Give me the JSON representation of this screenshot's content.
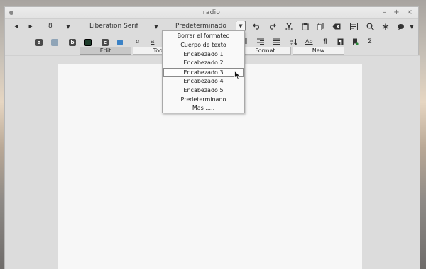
{
  "window": {
    "title": "radio",
    "controls": [
      "–",
      "+",
      "×"
    ]
  },
  "toolbar1": {
    "prev_icon": "◂",
    "next_icon": "▸",
    "font_size": "8",
    "font_name": "Liberation Serif",
    "paragraph_style": "Predeterminado",
    "arrow": "▼"
  },
  "toolbar2": {
    "swatch_a": "a",
    "swatch_b": "b",
    "swatch_c": "c",
    "italic_a": "a",
    "underline_a": "a",
    "pilcrow": "¶",
    "sigma": "Σ",
    "spell": "Ab"
  },
  "tabs": [
    "Edit",
    "Tool",
    "Format",
    "New"
  ],
  "style_menu": {
    "items": [
      "Borrar el formateo",
      "Cuerpo de texto",
      "Encabezado 1",
      "Encabezado 2",
      "Encabezado 3",
      "Encabezado 4",
      "Encabezado 5",
      "Predeterminado",
      "Mas ....."
    ],
    "selected": "Encabezado 3"
  },
  "colors": {
    "swatch_dark": "#4a4a4a",
    "swatch_blue_grey": "#8fa4b7",
    "swatch_black_green": "#1d3b2a",
    "swatch_blue": "#3b82c6"
  }
}
